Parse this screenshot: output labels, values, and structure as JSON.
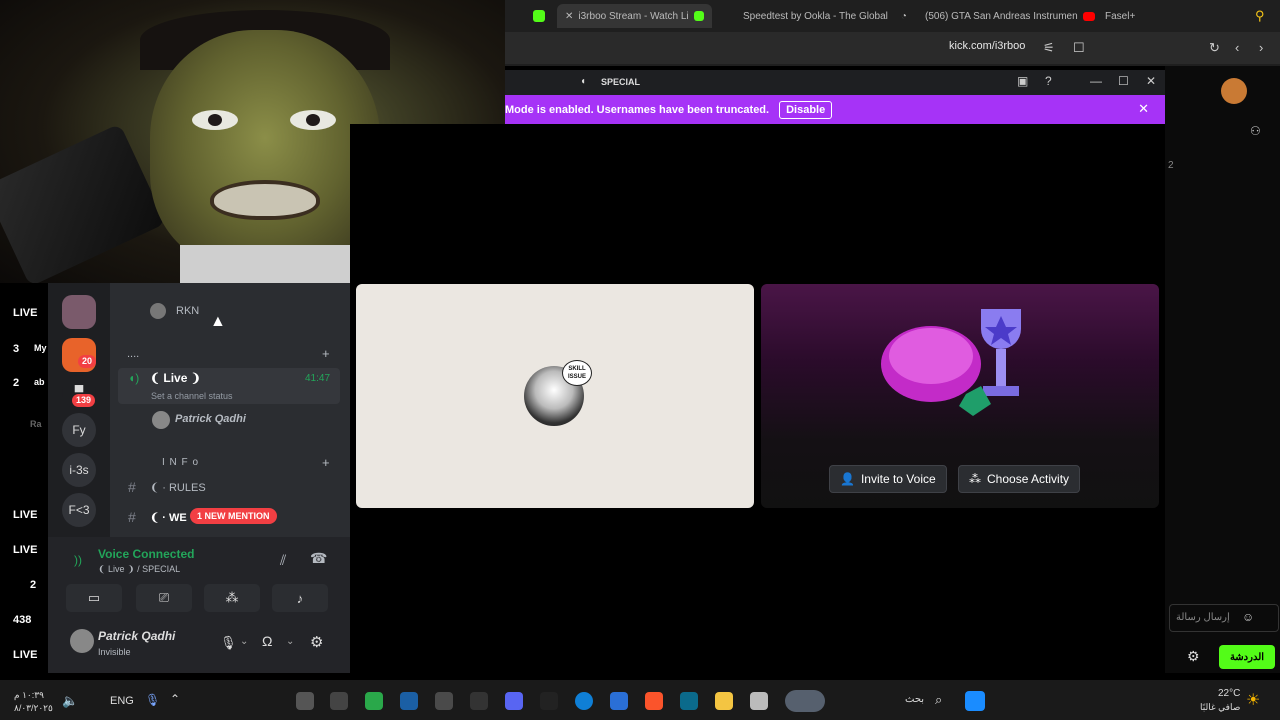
{
  "browser": {
    "tabs": [
      {
        "label": "i3rboo Stream - Watch Li",
        "active": true
      },
      {
        "label": "Speedtest by Ookla - The Global"
      },
      {
        "label": "(506) GTA San Andreas Instrumen"
      },
      {
        "label": "Fasel+"
      }
    ],
    "url": "kick.com/i3rboo"
  },
  "discord": {
    "title": "SPECIAL",
    "banner_text": "Mode is enabled. Usernames have been truncated.",
    "banner_button": "Disable",
    "servers": [
      {
        "label": "Fy"
      },
      {
        "label": "i-3s"
      },
      {
        "label": "F<3"
      }
    ],
    "server_badges": [
      "20",
      "139"
    ],
    "channels": {
      "member_top": "RKN",
      "category_dots": "....",
      "voice_channel": "❨ Live ❩",
      "voice_time": "41:47",
      "channel_status": "Set a channel status",
      "voice_member": "Patrick Qadhi",
      "info_category": "I N F o",
      "rules": "❨ · RULES",
      "we": "❨ · WE",
      "mention_badge": "1 NEW MENTION"
    },
    "voice_panel": {
      "status": "Voice Connected",
      "channel": "❨ Live ❩ / SPECIAL"
    },
    "user": {
      "name": "Patrick Qadhi",
      "status": "Invisible"
    },
    "tile_left_badge": "SKILL ISSUE",
    "invite_button": "Invite to Voice",
    "activity_button": "Choose Activity"
  },
  "overlay": {
    "live_labels": [
      "LIVE",
      "LIVE",
      "LIVE",
      "LIVE",
      "LIVE"
    ],
    "numbers": [
      "3",
      "2",
      "2",
      "438"
    ],
    "snippets": [
      "My",
      "ab",
      "Ra"
    ]
  },
  "chat": {
    "counter": "2",
    "input_placeholder": "إرسال رسالة",
    "send_button": "الدردشة"
  },
  "taskbar": {
    "language": "ENG",
    "search_label": "بحث",
    "weather_temp": "22°C",
    "weather_desc": "صافي غالبًا",
    "time": "١٠:٣٩ م",
    "date": "٨/٠٣/٢٠٢٥"
  }
}
